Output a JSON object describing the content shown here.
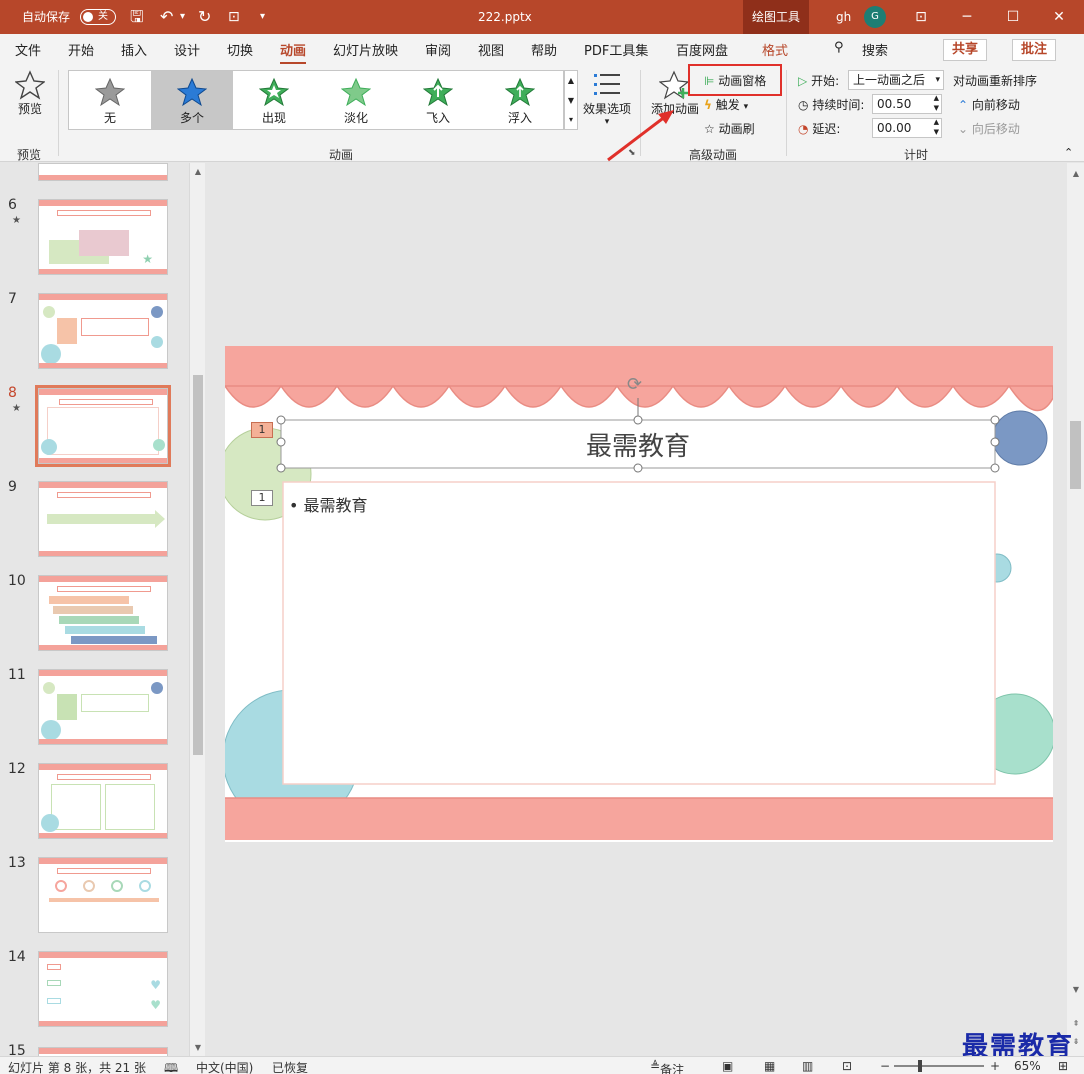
{
  "titlebar": {
    "autosave_label": "自动保存",
    "autosave_state": "关",
    "filename": "222.pptx",
    "context_tab": "绘图工具",
    "user": "gh",
    "avatar_letter": "G"
  },
  "tabs": [
    "文件",
    "开始",
    "插入",
    "设计",
    "切换",
    "动画",
    "幻灯片放映",
    "审阅",
    "视图",
    "帮助",
    "PDF工具集",
    "百度网盘",
    "格式"
  ],
  "search_label": "搜索",
  "share_label": "共享",
  "comment_label": "批注",
  "ribbon": {
    "preview": {
      "button": "预览",
      "group": "预览"
    },
    "animation": {
      "group": "动画",
      "gallery": [
        {
          "label": "无",
          "color": "#9a9a9a",
          "selected": false
        },
        {
          "label": "多个",
          "color": "#2b7bd6",
          "selected": true
        },
        {
          "label": "出现",
          "color": "#3fae5a",
          "selected": false
        },
        {
          "label": "淡化",
          "color": "#7fca8a",
          "selected": false
        },
        {
          "label": "飞入",
          "color": "#3fae5a",
          "selected": false
        },
        {
          "label": "浮入",
          "color": "#3fae5a",
          "selected": false
        }
      ],
      "effect_options": "效果选项"
    },
    "advanced": {
      "group": "高级动画",
      "add_animation": "添加动画",
      "animation_pane": "动画窗格",
      "trigger": "触发",
      "painter": "动画刷"
    },
    "timing": {
      "group": "计时",
      "start_label": "开始:",
      "start_value": "上一动画之后",
      "duration_label": "持续时间:",
      "duration_value": "00.50",
      "delay_label": "延迟:",
      "delay_value": "00.00",
      "reorder": "对动画重新排序",
      "move_earlier": "向前移动",
      "move_later": "向后移动"
    }
  },
  "thumbnails": [
    {
      "num": "6",
      "star": true,
      "active": false
    },
    {
      "num": "7",
      "star": false,
      "active": false
    },
    {
      "num": "8",
      "star": true,
      "active": true
    },
    {
      "num": "9",
      "star": false,
      "active": false
    },
    {
      "num": "10",
      "star": false,
      "active": false
    },
    {
      "num": "11",
      "star": false,
      "active": false
    },
    {
      "num": "12",
      "star": false,
      "active": false
    },
    {
      "num": "13",
      "star": false,
      "active": false
    },
    {
      "num": "14",
      "star": false,
      "active": false
    },
    {
      "num": "15",
      "star": false,
      "active": false
    }
  ],
  "slide": {
    "title": "最需教育",
    "bullet": "最需教育",
    "anim_tag_title": "1",
    "anim_tag_body": "1"
  },
  "statusbar": {
    "slide_info": "幻灯片 第 8 张，共 21 张",
    "language": "中文(中国)",
    "recovered": "已恢复",
    "notes": "备注",
    "zoom": "65%"
  },
  "watermark": "最需教育",
  "colors": {
    "brand": "#b7472a",
    "awning": "#f6a59d",
    "circle_blue": "#7b98c4",
    "circle_teal": "#a9dbe2",
    "circle_green": "#d6e8c2",
    "highlight_box": "#e0302a"
  }
}
